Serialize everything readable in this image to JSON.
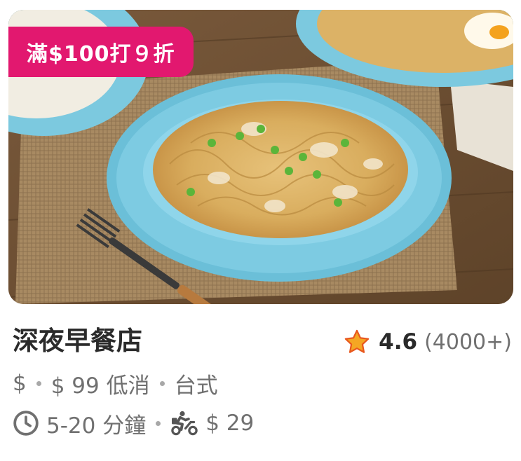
{
  "promo": {
    "label": "滿$100打９折"
  },
  "restaurant": {
    "name": "深夜早餐店",
    "rating": "4.6",
    "rating_count": "(4000+)",
    "price_level": "$",
    "min_order": "$ 99 低消",
    "cuisine": "台式",
    "delivery_time": "5-20 分鐘",
    "delivery_fee": "$ 29"
  },
  "icons": {
    "rating": "star-icon",
    "time": "clock-icon",
    "delivery": "scooter-icon"
  },
  "colors": {
    "promo_bg": "#e2186f",
    "star": "#f5a623",
    "text_primary": "#2a2a2a",
    "text_secondary": "#707070"
  }
}
